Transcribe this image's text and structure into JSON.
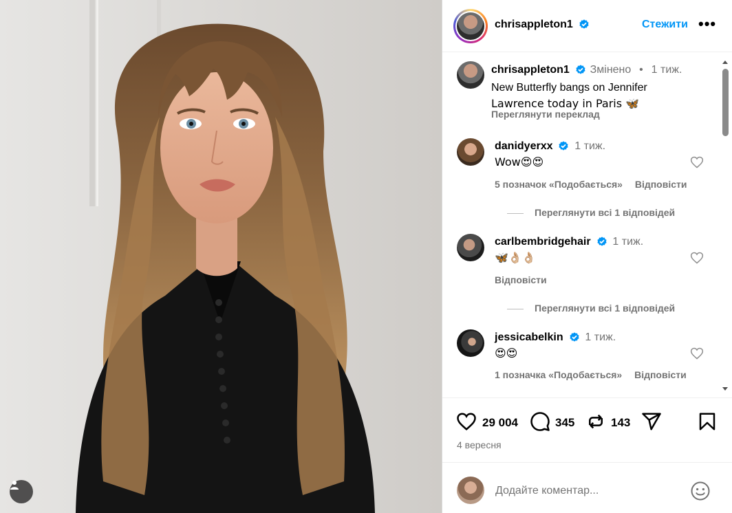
{
  "post": {
    "author": "chrisappleton1",
    "follow_label": "Стежити",
    "more_label": "•••"
  },
  "caption": {
    "author": "chrisappleton1",
    "edited": "Змінено",
    "separator": "•",
    "time": "1 тиж.",
    "text_line1": "New Butterfly bangs on Jennifer",
    "text_line2": "Lawrence today in Paris 🦋",
    "translate": "Переглянути переклад"
  },
  "comments": [
    {
      "author": "danidyerxx",
      "time": "1 тиж.",
      "text": "Wow😍😍",
      "likes": "5 позначок «Подобається»",
      "reply": "Відповісти",
      "view_replies": "Переглянути всі 1 відповідей"
    },
    {
      "author": "carlbembridgehair",
      "time": "1 тиж.",
      "text": "🦋👌🏼👌🏼",
      "likes": "",
      "reply": "Відповісти",
      "view_replies": "Переглянути всі 1 відповідей"
    },
    {
      "author": "jessicabelkin",
      "time": "1 тиж.",
      "text": "😍😍",
      "likes": "1 позначка «Подобається»",
      "reply": "Відповісти"
    }
  ],
  "stats": {
    "likes": "29 004",
    "comments": "345",
    "reposts": "143"
  },
  "date": "4 вересня",
  "comment_input": {
    "placeholder": "Додайте коментар..."
  },
  "icons": {
    "like": "heart-icon",
    "comment": "comment-icon",
    "repost": "repost-icon",
    "share": "share-icon",
    "save": "bookmark-icon",
    "emoji": "emoji-icon",
    "user": "user-icon",
    "verified": "verified-badge-icon"
  },
  "colors": {
    "accent": "#0095f6",
    "muted": "#737373",
    "verified": "#0095f6"
  }
}
